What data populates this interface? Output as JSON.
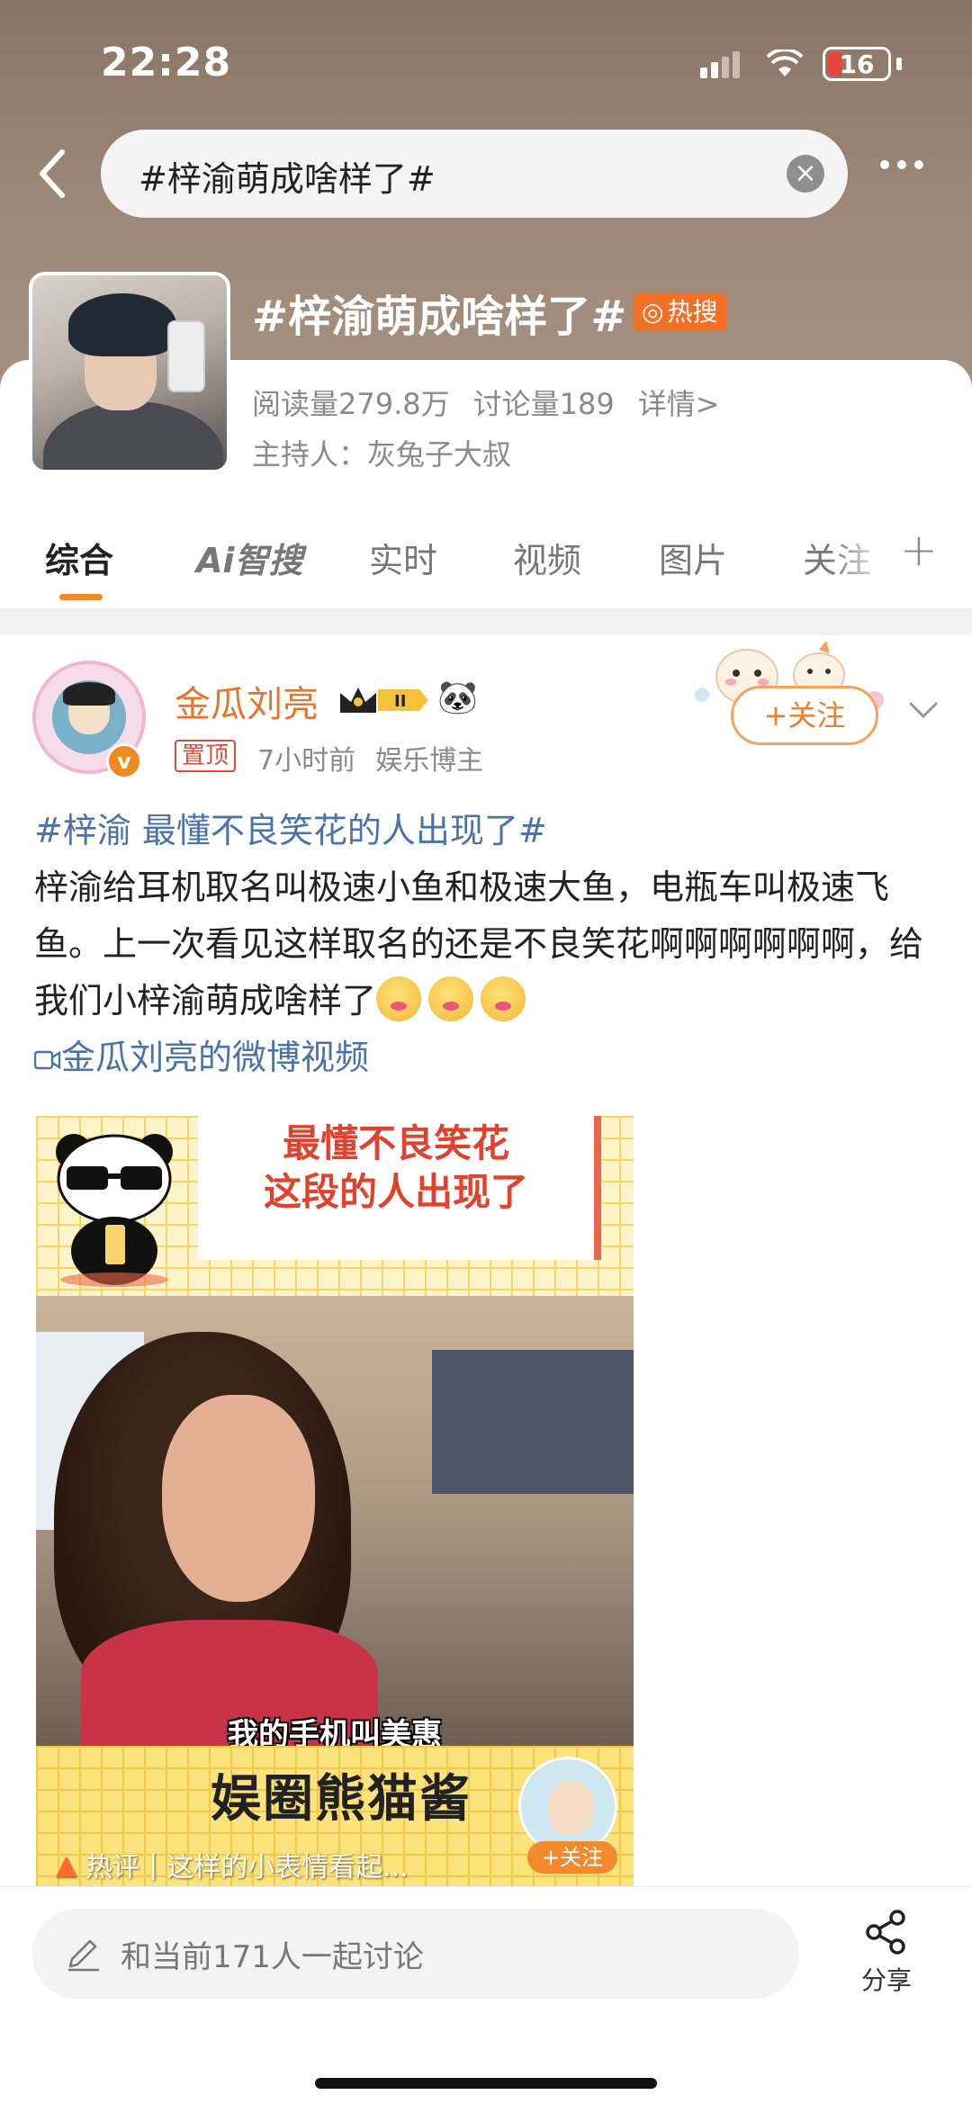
{
  "status_bar": {
    "time": "22:28",
    "battery": "16"
  },
  "search": {
    "query": "#梓渝萌成啥样了#"
  },
  "topic": {
    "title": "#梓渝萌成啥样了#",
    "hot_badge": "热搜",
    "reads": "阅读量279.8万",
    "discussions": "讨论量189",
    "details": "详情>",
    "host": "主持人：灰兔子大叔"
  },
  "tabs": [
    {
      "label": "综合"
    },
    {
      "label": "Ai智搜"
    },
    {
      "label": "实时"
    },
    {
      "label": "视频"
    },
    {
      "label": "图片"
    },
    {
      "label": "关注"
    }
  ],
  "post": {
    "author": "金瓜刘亮",
    "pinned": "置顶",
    "time": "7小时前",
    "role": "娱乐博主",
    "follow": "+关注",
    "hashtag": "#梓渝 最懂不良笑花的人出现了#",
    "text": "梓渝给耳机取名叫极速小鱼和极速大鱼，电瓶车叫极速飞鱼。上一次看见这样取名的还是不良笑花啊啊啊啊啊啊，给我们小梓渝萌成啥样了",
    "video_link": "金瓜刘亮的微博视频",
    "video": {
      "title_line1": "最懂不良笑花",
      "title_line2": "这段的人出现了",
      "caption": "我的手机叫美惠",
      "brand": "娱圈熊猫酱",
      "hot_label": "热评",
      "hot_comment": "这样的小表情看起...",
      "follow": "+关注"
    }
  },
  "bottom": {
    "comment_placeholder": "和当前171人一起讨论",
    "share": "分享"
  }
}
